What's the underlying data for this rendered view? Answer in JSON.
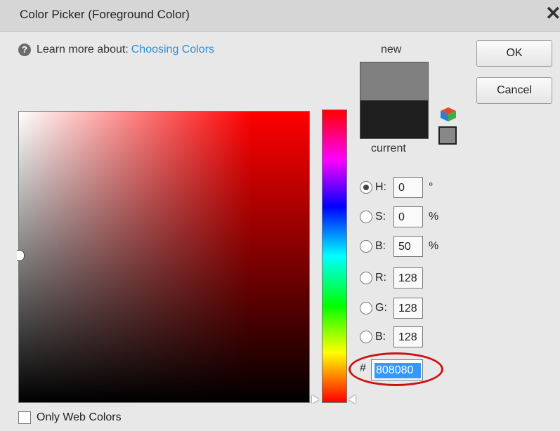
{
  "window": {
    "title": "Color Picker (Foreground Color)",
    "close_glyph": "✕"
  },
  "help": {
    "icon": "?",
    "prefix": "Learn more about:",
    "link": "Choosing Colors"
  },
  "swatch": {
    "new_label": "new",
    "current_label": "current",
    "new_color": "#808080",
    "current_color": "#1e1e1e"
  },
  "buttons": {
    "ok": "OK",
    "cancel": "Cancel"
  },
  "fields": {
    "h": {
      "label": "H:",
      "value": "0",
      "unit": "°",
      "selected": true
    },
    "s": {
      "label": "S:",
      "value": "0",
      "unit": "%",
      "selected": false
    },
    "b_hsb": {
      "label": "B:",
      "value": "50",
      "unit": "%",
      "selected": false
    },
    "r": {
      "label": "R:",
      "value": "128",
      "selected": false
    },
    "g": {
      "label": "G:",
      "value": "128",
      "selected": false
    },
    "b_rgb": {
      "label": "B:",
      "value": "128",
      "selected": false
    }
  },
  "hex": {
    "hash": "#",
    "value": "808080"
  },
  "web_colors": {
    "label": "Only Web Colors",
    "checked": false
  },
  "icons": [
    "help-icon",
    "close-icon",
    "color-cube-icon",
    "web-safe-swatch-icon"
  ],
  "colors": {
    "annotation": "#cc1111",
    "link": "#2d8fd8",
    "selection": "#3399ff"
  }
}
